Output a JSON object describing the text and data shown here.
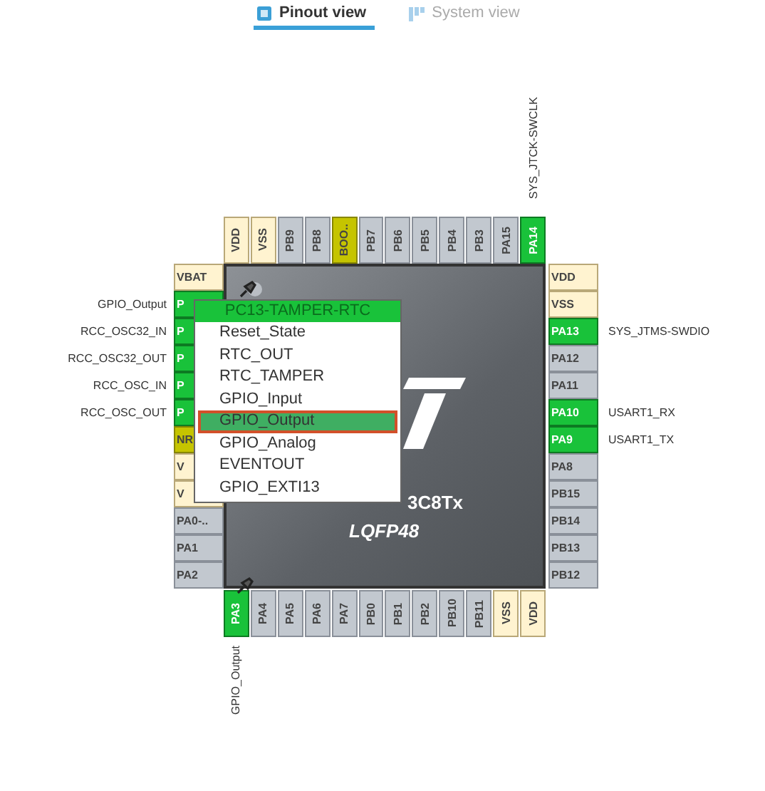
{
  "tabs": [
    {
      "label": "Pinout view",
      "selected": true
    },
    {
      "label": "System view",
      "selected": false
    }
  ],
  "package": {
    "part": "3C8Tx",
    "name": "LQFP48"
  },
  "pins": {
    "top": [
      {
        "label": "VDD",
        "kind": "power"
      },
      {
        "label": "VSS",
        "kind": "power"
      },
      {
        "label": "PB9",
        "kind": "io"
      },
      {
        "label": "PB8",
        "kind": "io"
      },
      {
        "label": "BOO..",
        "kind": "special"
      },
      {
        "label": "PB7",
        "kind": "io"
      },
      {
        "label": "PB6",
        "kind": "io"
      },
      {
        "label": "PB5",
        "kind": "io"
      },
      {
        "label": "PB4",
        "kind": "io"
      },
      {
        "label": "PB3",
        "kind": "io"
      },
      {
        "label": "PA15",
        "kind": "io"
      },
      {
        "label": "PA14",
        "kind": "assigned",
        "signal": "SYS_JTCK-SWCLK"
      }
    ],
    "left": [
      {
        "label": "VBAT",
        "kind": "power"
      },
      {
        "label": "P",
        "kind": "assigned",
        "signal": "GPIO_Output",
        "pinned": true
      },
      {
        "label": "P",
        "kind": "assigned",
        "signal": "RCC_OSC32_IN"
      },
      {
        "label": "P",
        "kind": "assigned",
        "signal": "RCC_OSC32_OUT"
      },
      {
        "label": "P",
        "kind": "assigned",
        "signal": "RCC_OSC_IN"
      },
      {
        "label": "P",
        "kind": "assigned",
        "signal": "RCC_OSC_OUT"
      },
      {
        "label": "NR",
        "kind": "special"
      },
      {
        "label": "V",
        "kind": "power"
      },
      {
        "label": "V",
        "kind": "power"
      },
      {
        "label": "PA0-..",
        "kind": "io"
      },
      {
        "label": "PA1",
        "kind": "io"
      },
      {
        "label": "PA2",
        "kind": "io"
      }
    ],
    "right": [
      {
        "label": "VDD",
        "kind": "power"
      },
      {
        "label": "VSS",
        "kind": "power"
      },
      {
        "label": "PA13",
        "kind": "assigned",
        "signal": "SYS_JTMS-SWDIO"
      },
      {
        "label": "PA12",
        "kind": "io"
      },
      {
        "label": "PA11",
        "kind": "io"
      },
      {
        "label": "PA10",
        "kind": "assigned",
        "signal": "USART1_RX"
      },
      {
        "label": "PA9",
        "kind": "assigned",
        "signal": "USART1_TX"
      },
      {
        "label": "PA8",
        "kind": "io"
      },
      {
        "label": "PB15",
        "kind": "io"
      },
      {
        "label": "PB14",
        "kind": "io"
      },
      {
        "label": "PB13",
        "kind": "io"
      },
      {
        "label": "PB12",
        "kind": "io"
      }
    ],
    "bottom": [
      {
        "label": "PA3",
        "kind": "assigned",
        "signal": "GPIO_Output",
        "pinned": true
      },
      {
        "label": "PA4",
        "kind": "io"
      },
      {
        "label": "PA5",
        "kind": "io"
      },
      {
        "label": "PA6",
        "kind": "io"
      },
      {
        "label": "PA7",
        "kind": "io"
      },
      {
        "label": "PB0",
        "kind": "io"
      },
      {
        "label": "PB1",
        "kind": "io"
      },
      {
        "label": "PB2",
        "kind": "io"
      },
      {
        "label": "PB10",
        "kind": "io"
      },
      {
        "label": "PB11",
        "kind": "io"
      },
      {
        "label": "VSS",
        "kind": "power"
      },
      {
        "label": "VDD",
        "kind": "power"
      }
    ]
  },
  "pin_menu": {
    "title": "PC13-TAMPER-RTC",
    "items": [
      {
        "label": "Reset_State",
        "selected": false
      },
      {
        "label": "RTC_OUT",
        "selected": false
      },
      {
        "label": "RTC_TAMPER",
        "selected": false
      },
      {
        "label": "GPIO_Input",
        "selected": false
      },
      {
        "label": "GPIO_Output",
        "selected": true
      },
      {
        "label": "GPIO_Analog",
        "selected": false
      },
      {
        "label": "EVENTOUT",
        "selected": false
      },
      {
        "label": "GPIO_EXTI13",
        "selected": false
      }
    ]
  }
}
